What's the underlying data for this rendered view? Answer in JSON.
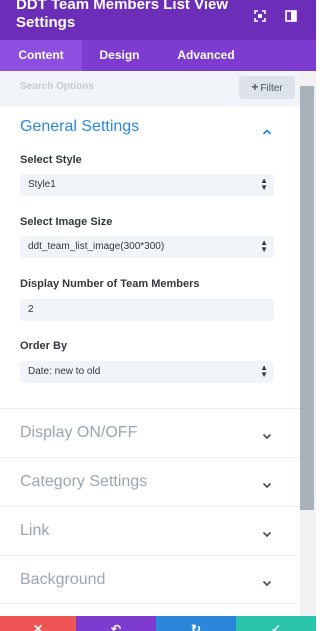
{
  "header": {
    "title": "DDT Team Members List View Settings",
    "icons": [
      "expand-icon",
      "sidebar-toggle-icon"
    ]
  },
  "tabs": [
    {
      "label": "Content",
      "active": true
    },
    {
      "label": "Design",
      "active": false
    },
    {
      "label": "Advanced",
      "active": false
    }
  ],
  "search": {
    "placeholder": "Search Options",
    "filter_label": "Filter"
  },
  "sections": {
    "general": {
      "title": "General Settings",
      "expanded": true,
      "fields": [
        {
          "label": "Select Style",
          "value": "Style1",
          "type": "select"
        },
        {
          "label": "Select Image Size",
          "value": "ddt_team_list_image(300*300)",
          "type": "select"
        },
        {
          "label": "Display Number of Team Members",
          "value": "2",
          "type": "input"
        },
        {
          "label": "Order By",
          "value": "Date: new to old",
          "type": "select"
        }
      ]
    },
    "collapsed": [
      {
        "title": "Display ON/OFF"
      },
      {
        "title": "Category Settings"
      },
      {
        "title": "Link"
      },
      {
        "title": "Background"
      }
    ]
  },
  "colors": {
    "header_bg": "#6c2eb9",
    "tabs_bg": "#7d3bcf",
    "accent_blue": "#2b87da",
    "discard": "#ef5555",
    "undo": "#7e3bd0",
    "redo": "#2b87da",
    "save": "#29c4a9"
  },
  "footer": {
    "buttons": [
      "discard-icon",
      "undo-icon",
      "redo-icon",
      "save-icon"
    ]
  }
}
